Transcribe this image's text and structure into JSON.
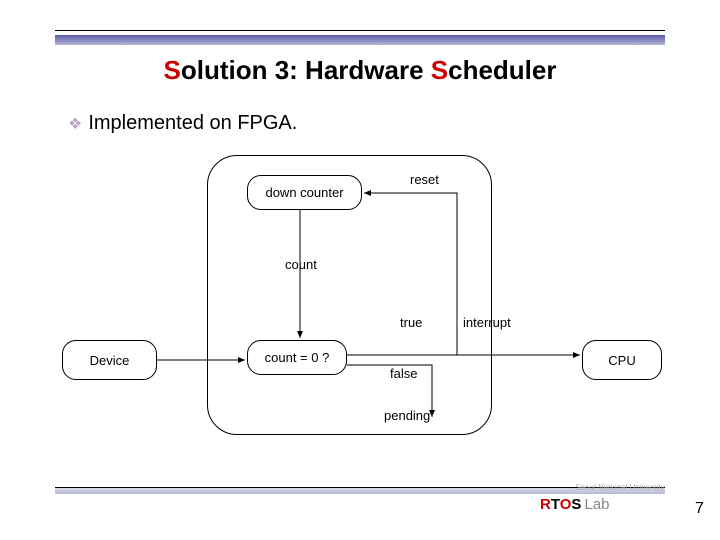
{
  "title_main": "olution 3: Hardware ",
  "title_s1": "S",
  "title_s2": "S",
  "title_end": "cheduler",
  "bullet_text": "Implemented on FPGA.",
  "boxes": {
    "down_counter": "down counter",
    "count_zero": "count = 0 ?",
    "device": "Device",
    "cpu": "CPU"
  },
  "labels": {
    "reset": "reset",
    "count": "count",
    "true": "true",
    "interrupt": "interrupt",
    "false": "false",
    "pending": "pending"
  },
  "logo": {
    "r": "R",
    "t": "T",
    "o": "O",
    "s": "S",
    "lab": "Lab"
  },
  "university": "Seoul National University",
  "page_number": "7"
}
